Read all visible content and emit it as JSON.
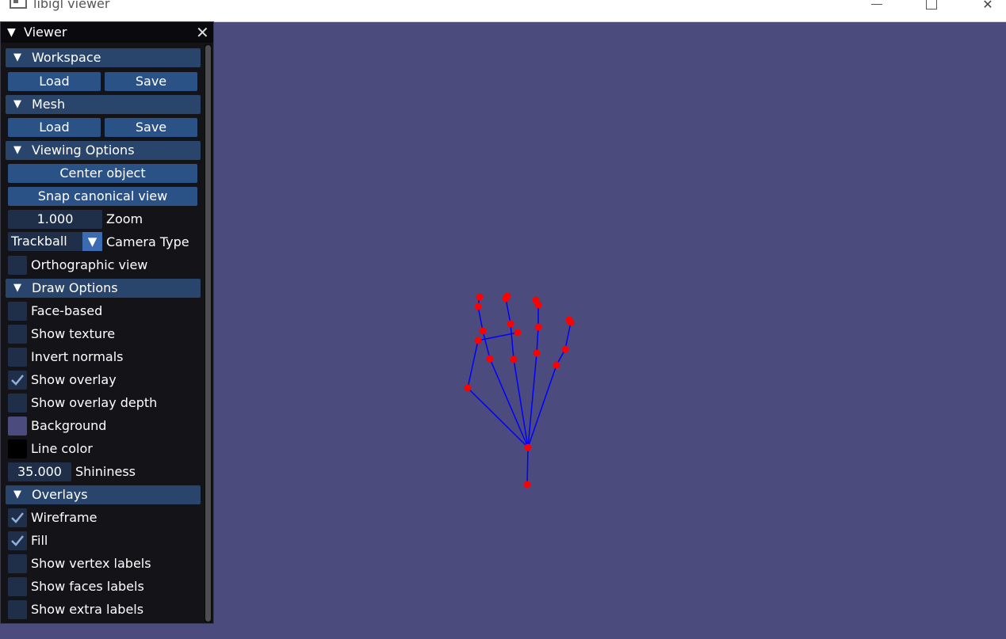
{
  "window": {
    "title": "libigl viewer"
  },
  "panel": {
    "title": "Viewer",
    "sections": {
      "workspace": {
        "label": "Workspace",
        "load": "Load",
        "save": "Save"
      },
      "mesh": {
        "label": "Mesh",
        "load": "Load",
        "save": "Save"
      },
      "viewing": {
        "label": "Viewing Options",
        "center_object": "Center object",
        "snap_view": "Snap canonical view",
        "zoom_value": "1.000",
        "zoom_label": "Zoom",
        "camera_type_value": "Trackball",
        "camera_type_label": "Camera Type",
        "orthographic_label": "Orthographic view",
        "orthographic_checked": false
      },
      "draw": {
        "label": "Draw Options",
        "face_based": {
          "label": "Face-based",
          "checked": false
        },
        "show_texture": {
          "label": "Show texture",
          "checked": false
        },
        "invert_normals": {
          "label": "Invert normals",
          "checked": false
        },
        "show_overlay": {
          "label": "Show overlay",
          "checked": true
        },
        "show_overlay_depth": {
          "label": "Show overlay depth",
          "checked": false
        },
        "background": {
          "label": "Background",
          "color": "#4b4b7e"
        },
        "line_color": {
          "label": "Line color",
          "color": "#000000"
        },
        "shininess_value": "35.000",
        "shininess_label": "Shininess"
      },
      "overlays": {
        "label": "Overlays",
        "wireframe": {
          "label": "Wireframe",
          "checked": true
        },
        "fill": {
          "label": "Fill",
          "checked": true
        },
        "vertex_labels": {
          "label": "Show vertex labels",
          "checked": false
        },
        "faces_labels": {
          "label": "Show faces labels",
          "checked": false
        },
        "extra_labels": {
          "label": "Show extra labels",
          "checked": false
        }
      }
    }
  },
  "colors": {
    "viewport_background": "#4b4b7e",
    "skeleton_edge": "#0000ff",
    "skeleton_point": "#ff0000"
  }
}
